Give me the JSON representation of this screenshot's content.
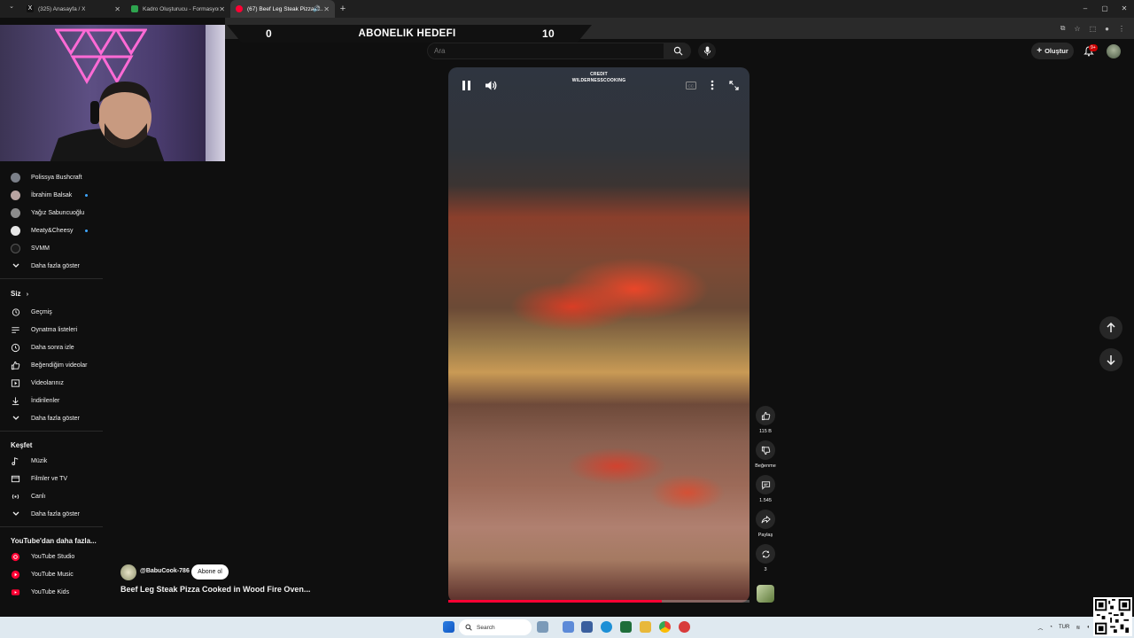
{
  "browser": {
    "tabs": [
      {
        "label": "(325) Anasayfa / X",
        "color": "#111111",
        "active": false
      },
      {
        "label": "Kadro Oluşturucu - Formasyon...",
        "color": "#2ea44f",
        "active": false
      },
      {
        "label": "(67) Beef Leg Steak Pizza C...",
        "color": "#ff0033",
        "active": true
      }
    ],
    "new_tab_symbol": "+",
    "window_controls": [
      "–",
      "▢",
      "✕"
    ]
  },
  "banner": {
    "left_value": "0",
    "title": "ABONELIK HEDEFI",
    "right_value": "10"
  },
  "header": {
    "search_placeholder": "Ara",
    "create_label": "Oluştur",
    "notification_count": "9+"
  },
  "sidebar": {
    "channels": [
      {
        "name": "Polissya Bushcraft",
        "color": "#7a7f88",
        "dot": false
      },
      {
        "name": "İbrahim Balsak",
        "color": "#b8a3a0",
        "dot": true
      },
      {
        "name": "Yağız Sabuncuoğlu",
        "color": "#8c8c8c",
        "dot": false
      },
      {
        "name": "Meaty&Cheesy",
        "color": "#e6e6e6",
        "dot": true
      },
      {
        "name": "SVMM",
        "color": "#1a1a1a",
        "dot": false
      }
    ],
    "channels_more": "Daha fazla göster",
    "you_heading": "Siz",
    "you_items": [
      {
        "label": "Geçmiş",
        "icon": "history-icon"
      },
      {
        "label": "Oynatma listeleri",
        "icon": "playlist-icon"
      },
      {
        "label": "Daha sonra izle",
        "icon": "watch-later-icon"
      },
      {
        "label": "Beğendiğim videolar",
        "icon": "like-icon"
      },
      {
        "label": "Videolarınız",
        "icon": "your-videos-icon"
      },
      {
        "label": "İndirilenler",
        "icon": "download-icon"
      }
    ],
    "you_more": "Daha fazla göster",
    "explore_heading": "Keşfet",
    "explore_items": [
      {
        "label": "Müzik",
        "icon": "music-icon"
      },
      {
        "label": "Filmler ve TV",
        "icon": "movies-icon"
      },
      {
        "label": "Canlı",
        "icon": "live-icon"
      }
    ],
    "explore_more": "Daha fazla göster",
    "more_heading": "YouTube'dan daha fazla...",
    "more_items": [
      {
        "label": "YouTube Studio",
        "icon": "youtube-studio-icon"
      },
      {
        "label": "YouTube Music",
        "icon": "youtube-music-icon"
      },
      {
        "label": "YouTube Kids",
        "icon": "youtube-kids-icon"
      }
    ]
  },
  "video": {
    "credit_line1": "CREDIT",
    "credit_line2": "WILDERNESSCOOKING",
    "progress_fraction": 0.71,
    "channel": "@BabuCook-786",
    "subscribe_label": "Abone ol",
    "title": "Beef Leg Steak Pizza Cooked in Wood Fire Oven..."
  },
  "actions": {
    "like_count": "115 B",
    "dislike_label": "Beğenme",
    "comment_count": "1.545",
    "share_label": "Paylaş",
    "remix_count": "3"
  },
  "taskbar": {
    "search_label": "Search",
    "language": "TUR"
  }
}
